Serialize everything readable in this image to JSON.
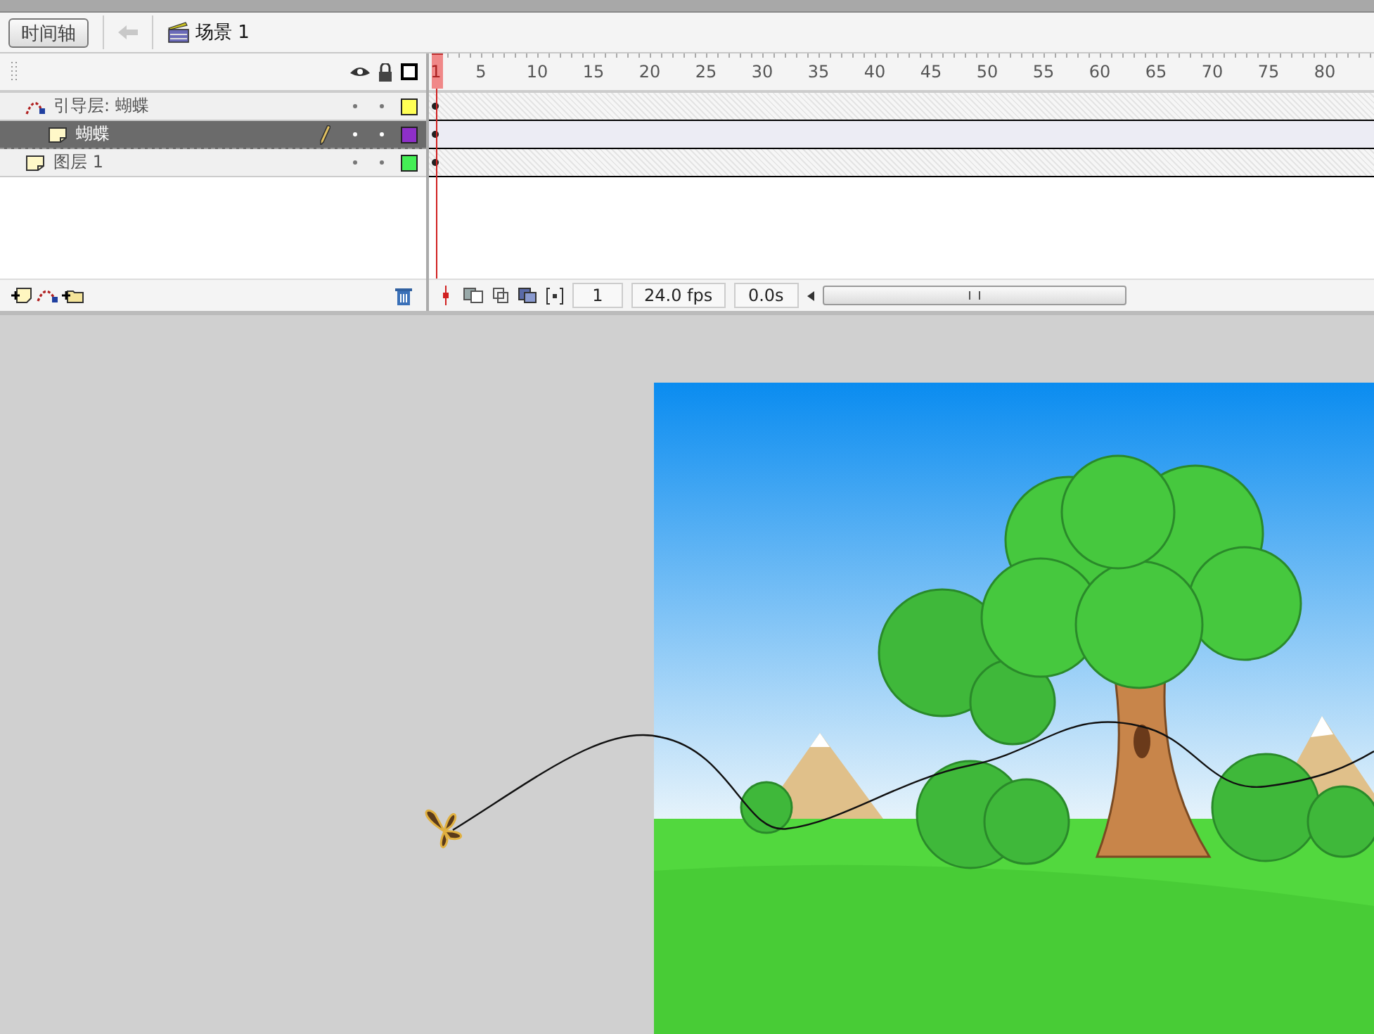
{
  "toolbar": {
    "timeline_button": "时间轴",
    "scene": "场景 1"
  },
  "timeline": {
    "ruler": [
      "1",
      "5",
      "10",
      "15",
      "20",
      "25",
      "30",
      "35",
      "40",
      "45",
      "50",
      "55",
      "60",
      "65",
      "70",
      "75",
      "80"
    ],
    "layers": [
      {
        "name": "引导层: 蝴蝶",
        "kind": "guide",
        "selected": false,
        "color": "#ffff55",
        "children": [
          {
            "name": "蝴蝶",
            "kind": "normal",
            "selected": true,
            "color": "#8e2fc8"
          }
        ]
      },
      {
        "name": "图层 1",
        "kind": "normal",
        "selected": false,
        "color": "#44ee55"
      }
    ],
    "status": {
      "frame": "1",
      "fps": "24.0 fps",
      "time": "0.0s"
    }
  }
}
